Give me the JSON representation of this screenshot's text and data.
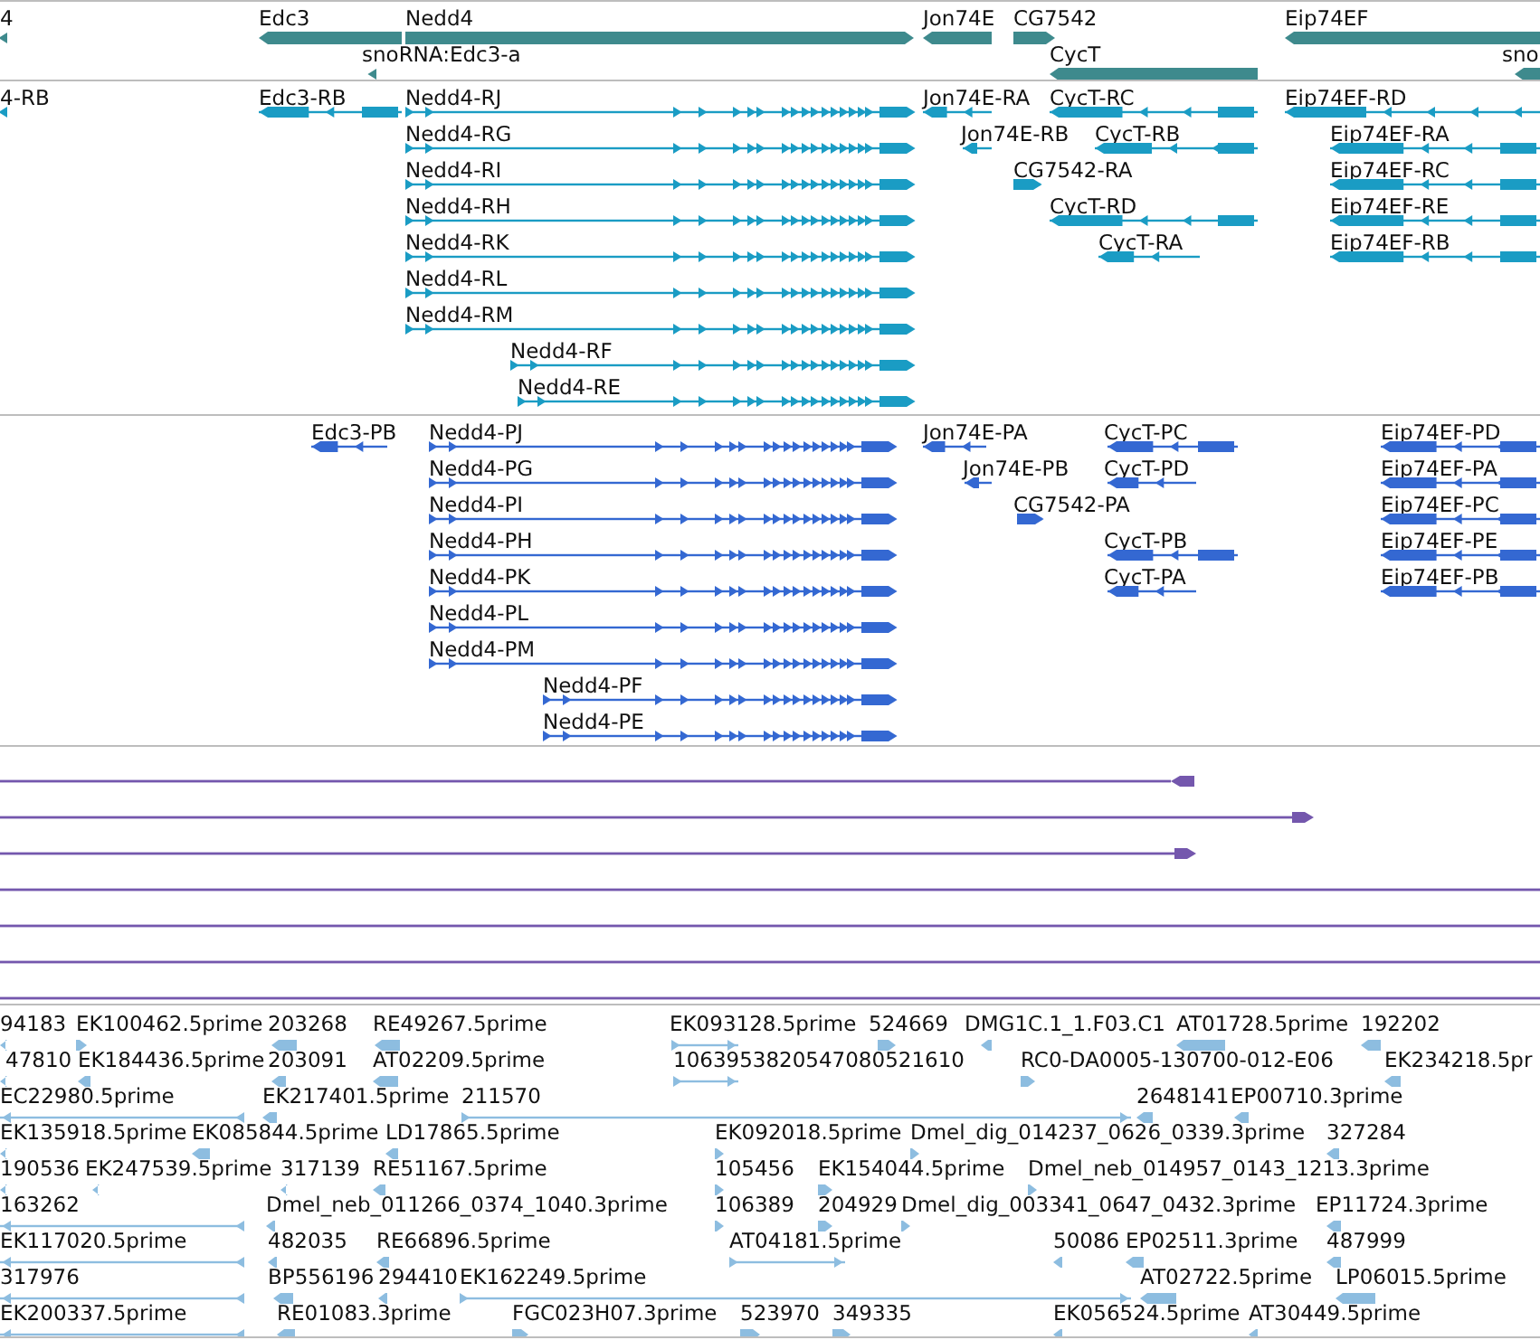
{
  "tracks": [
    {
      "kind": "gene",
      "features": [
        {
          "label": "4",
          "reverse": true
        },
        {
          "label": "Edc3",
          "reverse": true
        },
        {
          "label": "Nedd4",
          "reverse": false
        },
        {
          "label": "Jon74E",
          "reverse": true
        },
        {
          "label": "CG7542",
          "reverse": false
        },
        {
          "label": "Eip74EF",
          "reverse": true
        },
        {
          "label": "snoRNA:Edc3-a",
          "reverse": true
        },
        {
          "label": "CycT",
          "reverse": true
        },
        {
          "label": "sno",
          "reverse": true
        }
      ]
    },
    {
      "kind": "transcript",
      "features": [
        {
          "label": "4-RB",
          "reverse": true
        },
        {
          "label": "Edc3-RB",
          "reverse": true
        },
        {
          "label": "Nedd4-RJ",
          "reverse": false
        },
        {
          "label": "Nedd4-RG",
          "reverse": false
        },
        {
          "label": "Nedd4-RI",
          "reverse": false
        },
        {
          "label": "Nedd4-RH",
          "reverse": false
        },
        {
          "label": "Nedd4-RK",
          "reverse": false
        },
        {
          "label": "Nedd4-RL",
          "reverse": false
        },
        {
          "label": "Nedd4-RM",
          "reverse": false
        },
        {
          "label": "Nedd4-RF",
          "reverse": false
        },
        {
          "label": "Nedd4-RE",
          "reverse": false
        },
        {
          "label": "Jon74E-RA",
          "reverse": true
        },
        {
          "label": "Jon74E-RB",
          "reverse": true
        },
        {
          "label": "CycT-RC",
          "reverse": true
        },
        {
          "label": "CycT-RB",
          "reverse": true
        },
        {
          "label": "CG7542-RA",
          "reverse": false
        },
        {
          "label": "CycT-RD",
          "reverse": true
        },
        {
          "label": "CycT-RA",
          "reverse": true
        },
        {
          "label": "Eip74EF-RD",
          "reverse": true
        },
        {
          "label": "Eip74EF-RA",
          "reverse": true
        },
        {
          "label": "Eip74EF-RC",
          "reverse": true
        },
        {
          "label": "Eip74EF-RE",
          "reverse": true
        },
        {
          "label": "Eip74EF-RB",
          "reverse": true
        }
      ]
    },
    {
      "kind": "protein",
      "features": [
        {
          "label": "Edc3-PB",
          "reverse": true
        },
        {
          "label": "Nedd4-PJ",
          "reverse": false
        },
        {
          "label": "Nedd4-PG",
          "reverse": false
        },
        {
          "label": "Nedd4-PI",
          "reverse": false
        },
        {
          "label": "Nedd4-PH",
          "reverse": false
        },
        {
          "label": "Nedd4-PK",
          "reverse": false
        },
        {
          "label": "Nedd4-PL",
          "reverse": false
        },
        {
          "label": "Nedd4-PM",
          "reverse": false
        },
        {
          "label": "Nedd4-PF",
          "reverse": false
        },
        {
          "label": "Nedd4-PE",
          "reverse": false
        },
        {
          "label": "Jon74E-PA",
          "reverse": true
        },
        {
          "label": "Jon74E-PB",
          "reverse": true
        },
        {
          "label": "CG7542-PA",
          "reverse": false
        },
        {
          "label": "CycT-PC",
          "reverse": true
        },
        {
          "label": "CycT-PD",
          "reverse": true
        },
        {
          "label": "CycT-PB",
          "reverse": true
        },
        {
          "label": "CycT-PA",
          "reverse": true
        },
        {
          "label": "Eip74EF-PD",
          "reverse": true
        },
        {
          "label": "Eip74EF-PA",
          "reverse": true
        },
        {
          "label": "Eip74EF-PC",
          "reverse": true
        },
        {
          "label": "Eip74EF-PE",
          "reverse": true
        },
        {
          "label": "Eip74EF-PB",
          "reverse": true
        }
      ]
    },
    {
      "kind": "alignment",
      "features": [
        {
          "kind": "ending",
          "reverse": true
        },
        {
          "kind": "ending",
          "reverse": false
        },
        {
          "kind": "ending",
          "reverse": false
        },
        {
          "kind": "spanning"
        },
        {
          "kind": "spanning"
        },
        {
          "kind": "spanning"
        },
        {
          "kind": "spanning"
        }
      ]
    },
    {
      "kind": "est",
      "features": [
        {
          "label": "94183",
          "reverse": true
        },
        {
          "label": "EK100462.5prime",
          "reverse": false
        },
        {
          "label": "203268",
          "reverse": true
        },
        {
          "label": "RE49267.5prime",
          "reverse": true
        },
        {
          "label": "EK093128.5prime",
          "reverse": false
        },
        {
          "label": "524669",
          "reverse": false
        },
        {
          "label": "DMG1C.1_1.F03.C1",
          "reverse": true
        },
        {
          "label": "AT01728.5prime",
          "reverse": true
        },
        {
          "label": "192202",
          "reverse": true
        },
        {
          "label": "47810",
          "reverse": true
        },
        {
          "label": "EK184436.5prime",
          "reverse": true
        },
        {
          "label": "203091",
          "reverse": true
        },
        {
          "label": "AT02209.5prime",
          "reverse": true
        },
        {
          "label": "1063953820547080521610",
          "reverse": false
        },
        {
          "label": "RC0-DA0005-130700-012-E06",
          "reverse": false
        },
        {
          "label": "EK234218.5pr",
          "reverse": true
        },
        {
          "label": "EC22980.5prime",
          "reverse": true
        },
        {
          "label": "EK217401.5prime",
          "reverse": true
        },
        {
          "label": "211570",
          "reverse": false
        },
        {
          "label": "2648141",
          "reverse": true
        },
        {
          "label": "EP00710.3prime",
          "reverse": true
        },
        {
          "label": "EK135918.5prime",
          "reverse": true
        },
        {
          "label": "EK085844.5prime",
          "reverse": true
        },
        {
          "label": "LD17865.5prime",
          "reverse": true
        },
        {
          "label": "EK092018.5prime",
          "reverse": false
        },
        {
          "label": "Dmel_dig_014237_0626_0339.3prime",
          "reverse": false
        },
        {
          "label": "327284",
          "reverse": true
        },
        {
          "label": "190536",
          "reverse": true
        },
        {
          "label": "EK247539.5prime",
          "reverse": true
        },
        {
          "label": "317139",
          "reverse": true
        },
        {
          "label": "RE51167.5prime",
          "reverse": true
        },
        {
          "label": "105456",
          "reverse": false
        },
        {
          "label": "EK154044.5prime",
          "reverse": false
        },
        {
          "label": "Dmel_neb_014957_0143_1213.3prime",
          "reverse": false
        },
        {
          "label": "163262",
          "reverse": true
        },
        {
          "label": "Dmel_neb_011266_0374_1040.3prime",
          "reverse": true
        },
        {
          "label": "106389",
          "reverse": false
        },
        {
          "label": "204929",
          "reverse": false
        },
        {
          "label": "Dmel_dig_003341_0647_0432.3prime",
          "reverse": false
        },
        {
          "label": "EP11724.3prime",
          "reverse": true
        },
        {
          "label": "EK117020.5prime",
          "reverse": true
        },
        {
          "label": "482035",
          "reverse": true
        },
        {
          "label": "RE66896.5prime",
          "reverse": true
        },
        {
          "label": "AT04181.5prime",
          "reverse": false
        },
        {
          "label": "50086",
          "reverse": true
        },
        {
          "label": "EP02511.3prime",
          "reverse": true
        },
        {
          "label": "487999",
          "reverse": true
        },
        {
          "label": "317976",
          "reverse": true
        },
        {
          "label": "BP556196",
          "reverse": true
        },
        {
          "label": "294410",
          "reverse": true
        },
        {
          "label": "EK162249.5prime",
          "reverse": false
        },
        {
          "label": "AT02722.5prime",
          "reverse": true
        },
        {
          "label": "LP06015.5prime",
          "reverse": true
        },
        {
          "label": "EK200337.5prime",
          "reverse": true
        },
        {
          "label": "RE01083.3prime",
          "reverse": true
        },
        {
          "label": "FGC023H07.3prime",
          "reverse": false
        },
        {
          "label": "523970",
          "reverse": false
        },
        {
          "label": "349335",
          "reverse": false
        },
        {
          "label": "EK056524.5prime",
          "reverse": true
        },
        {
          "label": "AT30449.5prime",
          "reverse": true
        }
      ]
    }
  ]
}
